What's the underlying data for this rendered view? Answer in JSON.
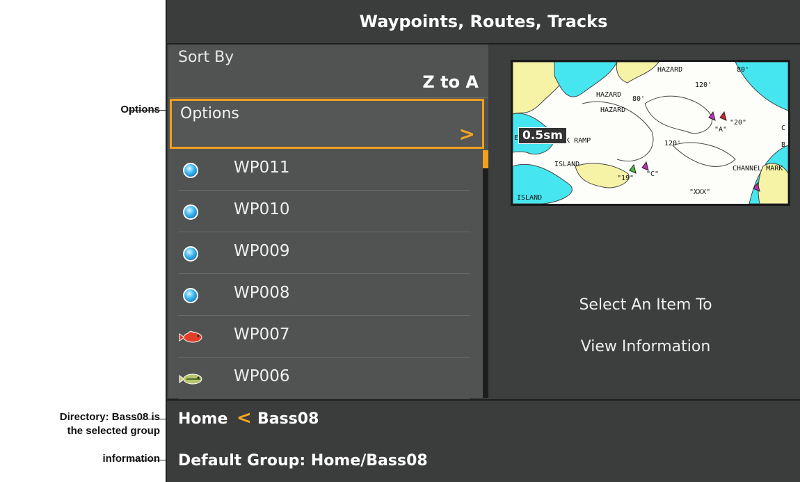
{
  "callouts": {
    "options": "Options",
    "directory_line1": "Directory: Bass08 is",
    "directory_line2": "the selected group",
    "information": "information"
  },
  "header": {
    "title": "Waypoints, Routes, Tracks"
  },
  "sort": {
    "label": "Sort By",
    "value": "Z to A"
  },
  "options": {
    "label": "Options",
    "arrow": ">"
  },
  "list": {
    "items": [
      {
        "label": "WP011",
        "icon": "waypoint-orb-icon"
      },
      {
        "label": "WP010",
        "icon": "waypoint-orb-icon"
      },
      {
        "label": "WP009",
        "icon": "waypoint-orb-icon"
      },
      {
        "label": "WP008",
        "icon": "waypoint-orb-icon"
      },
      {
        "label": "WP007",
        "icon": "red-fish-icon"
      },
      {
        "label": "WP006",
        "icon": "bass-fish-icon"
      }
    ]
  },
  "map": {
    "scale": "0.5sm",
    "labels": [
      "HAZARD",
      "120'",
      "HAZARD",
      "80'",
      "HAZARD",
      "PARK RAMP",
      "120'",
      "ISLAND",
      "\"19\"",
      "\"C\"",
      "\"A\"",
      "\"20\"",
      "CHANNEL MARK",
      "\"XXX\"",
      "ISLAND",
      "EEK",
      "80'",
      "C",
      "B"
    ],
    "colors": {
      "land": "#f7f3a6",
      "shallow": "#45e6f0",
      "water": "#fdfdfa"
    }
  },
  "info_panel": {
    "line1": "Select An Item To",
    "line2": "View Information"
  },
  "directory": {
    "home": "Home",
    "separator": "<",
    "group": "Bass08"
  },
  "info_bar": {
    "text": "Default Group: Home/Bass08"
  },
  "colors": {
    "accent": "#f0a11e",
    "panel": "#515252",
    "background": "#3c3d3d"
  }
}
